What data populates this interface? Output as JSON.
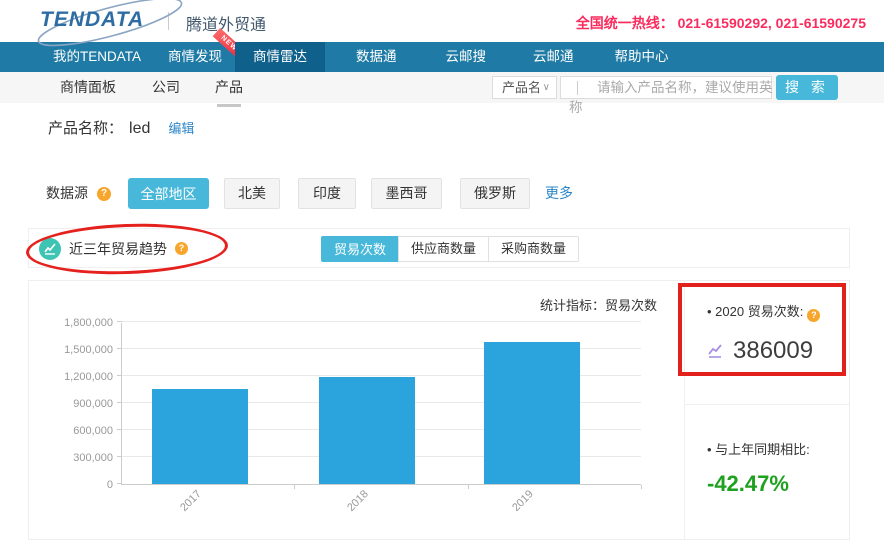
{
  "topbar": {
    "logo_text": "TENDATA",
    "brand_cn": "腾道外贸通",
    "hotline_label": "全国统一热线：",
    "hotline_numbers": "021-61590292, 021-61590275"
  },
  "navbar": {
    "items": [
      {
        "label": "我的TENDATA",
        "active": false
      },
      {
        "label": "商情发现",
        "active": false,
        "badge": "NEW"
      },
      {
        "label": "商情雷达",
        "active": true
      },
      {
        "label": "数据通",
        "active": false
      },
      {
        "label": "云邮搜",
        "active": false
      },
      {
        "label": "云邮通",
        "active": false
      },
      {
        "label": "帮助中心",
        "active": false
      }
    ]
  },
  "subnav": {
    "items": [
      "商情面板",
      "公司",
      "产品"
    ],
    "active_index": 2,
    "search": {
      "category_value": "产品名",
      "placeholder_line1": "请输入产品名称，建议使用英",
      "placeholder_line2": "称",
      "button_label": "搜 索"
    }
  },
  "product": {
    "label": "产品名称：",
    "value": "led",
    "edit_label": "编辑"
  },
  "datasource": {
    "label": "数据源",
    "regions": [
      "全部地区",
      "北美",
      "印度",
      "墨西哥",
      "俄罗斯"
    ],
    "active_index": 0,
    "more_label": "更多"
  },
  "trend_section": {
    "title": "近三年贸易趋势",
    "tabs": [
      "贸易次数",
      "供应商数量",
      "采购商数量"
    ],
    "active_tab_index": 0,
    "stat_label": "统计指标：贸易次数"
  },
  "chart_data": {
    "type": "bar",
    "title": "近三年贸易趋势",
    "categories": [
      "2017",
      "2018",
      "2019"
    ],
    "values": [
      1060000,
      1190000,
      1580000
    ],
    "xlabel": "",
    "ylabel": "",
    "ylim": [
      0,
      1800000
    ],
    "ytick_step": 300000,
    "ytick_labels": [
      "0",
      "300,000",
      "600,000",
      "900,000",
      "1,200,000",
      "1,500,000",
      "1,800,000"
    ],
    "grid": true,
    "legend_position": "none",
    "bar_color": "#2ba3dd"
  },
  "summary": {
    "current": {
      "label": "• 2020 贸易次数:",
      "value": "386009"
    },
    "compare": {
      "label": "• 与上年同期相比:",
      "value": "-42.47%"
    }
  },
  "icons": {
    "help": "?",
    "chevron_down": "∨"
  },
  "colors": {
    "nav_blue": "#1f7ba6",
    "nav_active_blue": "#0f618c",
    "accent_cyan": "#47b8d9",
    "bar_blue": "#2ba3dd",
    "hotline_red": "#fa2c5e",
    "annotation_red": "#e2211c",
    "positive_teal_icon": "#3fc4b4",
    "help_orange": "#f7a52b",
    "link_blue": "#2d86c8",
    "compare_green": "#1ea11e"
  }
}
